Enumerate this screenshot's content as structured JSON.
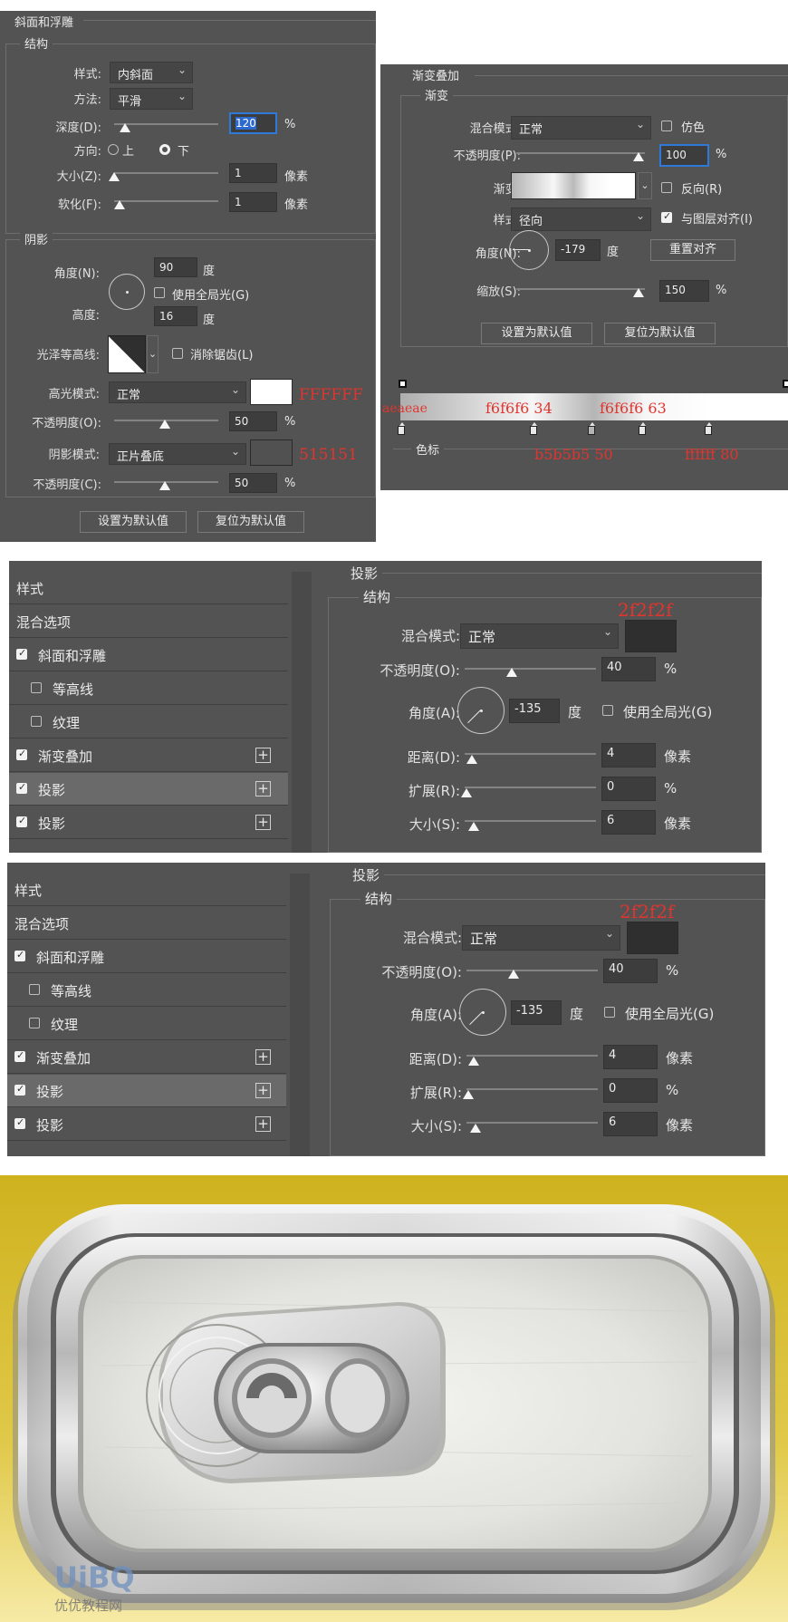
{
  "bevel": {
    "title": "斜面和浮雕",
    "structure": "结构",
    "style_label": "样式:",
    "style_value": "内斜面",
    "technique_label": "方法:",
    "technique_value": "平滑",
    "depth_label": "深度(D):",
    "depth_value": "120",
    "percent": "%",
    "direction_label": "方向:",
    "up": "上",
    "down": "下",
    "size_label": "大小(Z):",
    "size_value": "1",
    "soften_label": "软化(F):",
    "soften_value": "1",
    "pixel": "像素",
    "shading": "阴影",
    "angle_label": "角度(N):",
    "angle_value": "90",
    "degree": "度",
    "use_global": "使用全局光(G)",
    "altitude_label": "高度:",
    "altitude_value": "16",
    "gloss_label": "光泽等高线:",
    "antialias": "消除锯齿(L)",
    "highlight_label": "高光模式:",
    "highlight_value": "正常",
    "highlight_color": "#ffffff",
    "highlight_note": "FFFFFF",
    "hl_opacity_label": "不透明度(O):",
    "hl_opacity_value": "50",
    "shadow_label": "阴影模式:",
    "shadow_value": "正片叠底",
    "shadow_color": "#515151",
    "shadow_note": "515151",
    "sh_opacity_label": "不透明度(C):",
    "sh_opacity_value": "50",
    "btn_default": "设置为默认值",
    "btn_reset": "复位为默认值"
  },
  "gradient": {
    "title": "渐变叠加",
    "section": "渐变",
    "blend_label": "混合模式:",
    "blend_value": "正常",
    "dither": "仿色",
    "opacity_label": "不透明度(P):",
    "opacity_value": "100",
    "percent": "%",
    "gradient_label": "渐变:",
    "reverse": "反向(R)",
    "style_label": "样式:",
    "style_value": "径向",
    "align": "与图层对齐(I)",
    "angle_label": "角度(N):",
    "angle_value": "-179",
    "degree": "度",
    "reset_align": "重置对齐",
    "scale_label": "缩放(S):",
    "scale_value": "150",
    "btn_default": "设置为默认值",
    "btn_reset": "复位为默认值",
    "stops_label": "色标",
    "note_aeaeae": "aeaeae",
    "note_f6_34": "f6f6f6 34",
    "note_f6_63": "f6f6f6 63",
    "note_b5_50": "b5b5b5 50",
    "note_ff_80": "ffffff 80",
    "colors": {
      "c1": "#aeaeae",
      "c2": "#f6f6f6",
      "c3": "#b5b5b5",
      "c4": "#ffffff"
    }
  },
  "styles_list": {
    "header": "样式",
    "blend_options": "混合选项",
    "bevel": "斜面和浮雕",
    "contour": "等高线",
    "texture": "纹理",
    "gradient_overlay": "渐变叠加",
    "drop_shadow_1": "投影",
    "drop_shadow_2": "投影"
  },
  "shadow": {
    "title": "投影",
    "structure": "结构",
    "blend_label": "混合模式:",
    "blend_value": "正常",
    "color": "#2f2f2f",
    "color_note": "2f2f2f",
    "opacity_label": "不透明度(O):",
    "opacity_value": "40",
    "percent": "%",
    "angle_label": "角度(A):",
    "angle_value": "-135",
    "degree": "度",
    "use_global": "使用全局光(G)",
    "distance_label": "距离(D):",
    "distance_value": "4",
    "pixel": "像素",
    "spread_label": "扩展(R):",
    "spread_value": "0",
    "size_label": "大小(S):",
    "size_value": "6"
  },
  "artwork": {
    "watermark_logo": "UiBQ",
    "watermark_text": "优优教程网",
    "background": "#d6b82a"
  }
}
